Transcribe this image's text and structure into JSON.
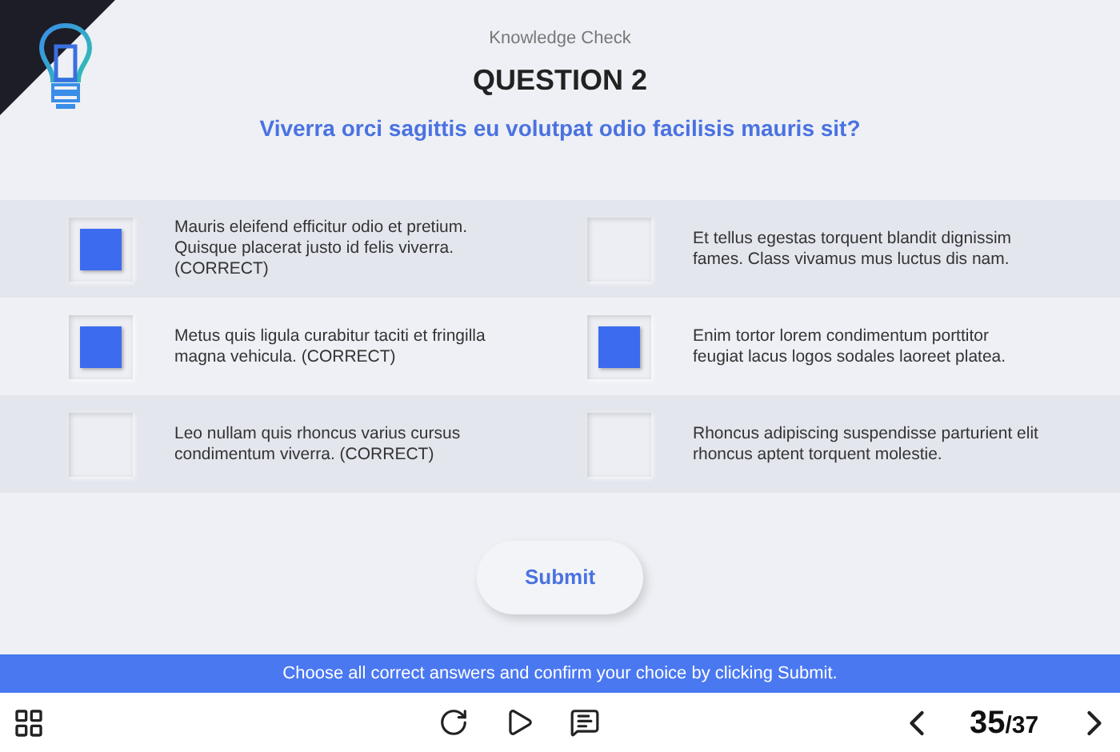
{
  "header": {
    "subtitle": "Knowledge Check",
    "title": "QUESTION 2",
    "question": "Viverra orci sagittis eu volutpat odio facilisis mauris sit?"
  },
  "options": [
    {
      "text": "Mauris eleifend efficitur odio et pretium. Quisque placerat justo id felis viverra. (CORRECT)",
      "checked": true
    },
    {
      "text": "Et tellus egestas torquent blandit dignissim fames. Class vivamus mus luctus dis nam.",
      "checked": false
    },
    {
      "text": "Metus quis ligula curabitur taciti et fringilla magna vehicula. (CORRECT)",
      "checked": true
    },
    {
      "text": "Enim tortor lorem condimentum porttitor feugiat lacus logos sodales laoreet platea.",
      "checked": true
    },
    {
      "text": "Leo nullam quis rhoncus varius cursus condimentum viverra. (CORRECT)",
      "checked": false
    },
    {
      "text": "Rhoncus adipiscing suspendisse parturient elit rhoncus aptent torquent molestie.",
      "checked": false
    }
  ],
  "submit": "Submit",
  "instruction": "Choose all correct answers and confirm your choice by clicking Submit.",
  "pager": {
    "current": "35",
    "total": "/37"
  }
}
